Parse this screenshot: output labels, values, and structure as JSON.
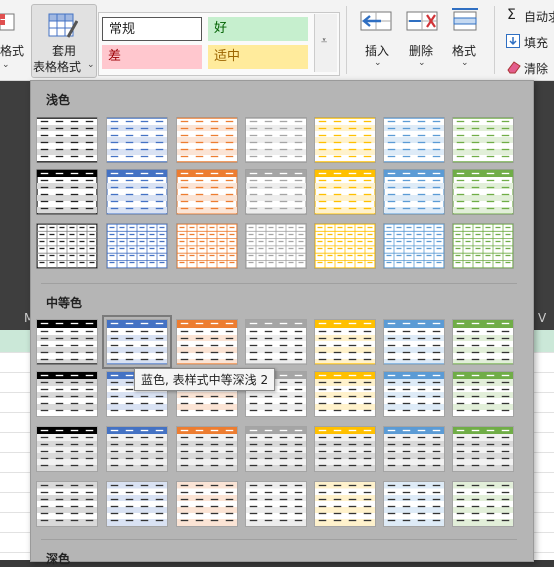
{
  "ribbon": {
    "format_left_label": "格式",
    "format_table_line1": "套用",
    "format_table_line2": "表格格式",
    "cell_styles": [
      {
        "label": "常规",
        "bg": "#ffffff",
        "fg": "#222222"
      },
      {
        "label": "好",
        "bg": "#c6efce",
        "fg": "#006100"
      },
      {
        "label": "差",
        "bg": "#ffc7ce",
        "fg": "#9c0006"
      },
      {
        "label": "适中",
        "bg": "#ffeb9c",
        "fg": "#9c6500"
      }
    ],
    "insert_label": "插入",
    "delete_label": "删除",
    "format_label": "格式",
    "autosum_label": "自动求",
    "fill_label": "填充",
    "clear_label": "清除"
  },
  "sheet": {
    "col_left": "M",
    "col_right": "V"
  },
  "gallery": {
    "sections": [
      {
        "title": "浅色"
      },
      {
        "title": "中等色"
      },
      {
        "title": "深色"
      }
    ],
    "accents": [
      "#000000",
      "#4472c4",
      "#ed7d31",
      "#a5a5a5",
      "#ffc000",
      "#5b9bd5",
      "#70ad47"
    ],
    "tints": [
      "#d9d9d9",
      "#d9e2f3",
      "#fbe4d5",
      "#ededed",
      "#fff2cc",
      "#deebf7",
      "#e2efd9"
    ],
    "tooltip": "蓝色, 表样式中等深浅 2"
  }
}
